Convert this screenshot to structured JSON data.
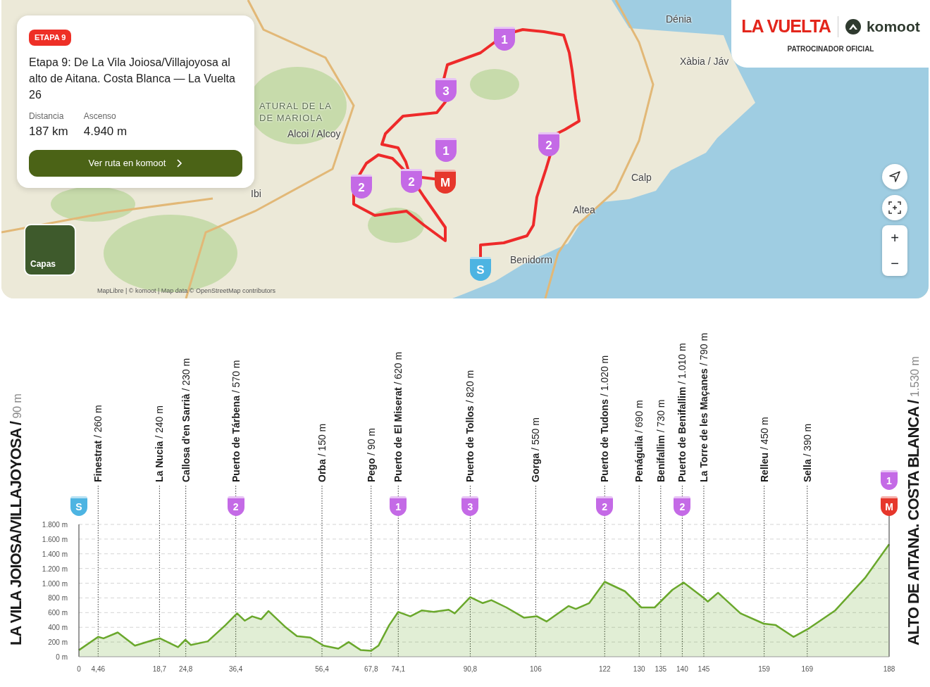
{
  "map": {
    "card": {
      "badge": "ETAPA 9",
      "title": "Etapa 9: De La Vila Joiosa/Villajoyosa al alto de Aitana. Costa Blanca — La Vuelta 26",
      "stats": [
        {
          "label": "Distancia",
          "value": "187 km"
        },
        {
          "label": "Ascenso",
          "value": "4.940 m"
        }
      ],
      "button": "Ver ruta en komoot"
    },
    "sponsor": {
      "brand": "LA VUELTA",
      "partner": "komoot",
      "caption": "PATROCINADOR OFICIAL"
    },
    "places": [
      "Dénia",
      "Xàbia / Jáv",
      "ATURAL DE LA",
      "DE MARIOLA",
      "Alcoi / Alcoy",
      "Calp",
      "Ibi",
      "Altea",
      "Benidorm"
    ],
    "markers": [
      {
        "text": "1",
        "kind": "climb"
      },
      {
        "text": "3",
        "kind": "climb"
      },
      {
        "text": "2",
        "kind": "climb"
      },
      {
        "text": "1",
        "kind": "climb"
      },
      {
        "text": "2",
        "kind": "climb"
      },
      {
        "text": "M",
        "kind": "finish"
      },
      {
        "text": "2",
        "kind": "climb"
      },
      {
        "text": "S",
        "kind": "start"
      }
    ],
    "layers_button": "Capas",
    "zoom_in": "+",
    "zoom_out": "−",
    "attribution": "MapLibre | © komoot | Map data © OpenStreetMap contributors"
  },
  "profile": {
    "start_title": "**LA VILA JOIOSA/VILLAJOYOSA /** 90 m",
    "finish_title": "**ALTO DE AITANA. COSTA BLANCA /** 1.530 m",
    "chart_data": {
      "type": "area",
      "xlim": [
        0,
        188
      ],
      "ylim": [
        0,
        1800
      ],
      "x": [
        0,
        4.46,
        5.7,
        9,
        13,
        17.4,
        18.8,
        23,
        24.7,
        26,
        29.9,
        34,
        36.7,
        38.5,
        40.2,
        42.3,
        44,
        47.8,
        50.6,
        53.7,
        56.8,
        60.2,
        62.6,
        65.4,
        67.8,
        69.5,
        72,
        74.1,
        76.9,
        79.6,
        82.3,
        85.8,
        87.2,
        90.8,
        93.7,
        95.7,
        99.2,
        103.3,
        106.3,
        108.5,
        113.6,
        115.3,
        118.4,
        122,
        126.7,
        130.5,
        133.6,
        137.7,
        140.3,
        145.2,
        145.9,
        148.3,
        153.5,
        158.9,
        161.7,
        165.8,
        169.5,
        175.5,
        182.4,
        188
      ],
      "series": [
        {
          "color": "#6aa82c",
          "values": [
            90,
            270,
            250,
            330,
            150,
            230,
            250,
            130,
            230,
            160,
            210,
            430,
            590,
            490,
            550,
            510,
            620,
            410,
            280,
            260,
            150,
            110,
            200,
            90,
            80,
            150,
            430,
            610,
            550,
            630,
            610,
            640,
            590,
            810,
            730,
            770,
            670,
            530,
            550,
            480,
            690,
            650,
            730,
            1020,
            890,
            670,
            670,
            910,
            1010,
            790,
            750,
            870,
            590,
            450,
            430,
            270,
            390,
            630,
            1070,
            1530
          ]
        }
      ],
      "yticks": [
        {
          "value": 0,
          "label": "0 m"
        },
        {
          "value": 200,
          "label": "200 m"
        },
        {
          "value": 400,
          "label": "400 m"
        },
        {
          "value": 600,
          "label": "600 m"
        },
        {
          "value": 800,
          "label": "800 m"
        },
        {
          "value": 1000,
          "label": "1.000 m"
        },
        {
          "value": 1200,
          "label": "1.200 m"
        },
        {
          "value": 1400,
          "label": "1.400 m"
        },
        {
          "value": 1600,
          "label": "1.600 m"
        },
        {
          "value": 1800,
          "label": "1.800 m"
        }
      ],
      "xticks": [
        {
          "value": 0,
          "label": "0"
        },
        {
          "value": 4.46,
          "label": "4,46"
        },
        {
          "value": 18.7,
          "label": "18,7"
        },
        {
          "value": 24.8,
          "label": "24,8"
        },
        {
          "value": 36.4,
          "label": "36,4"
        },
        {
          "value": 56.4,
          "label": "56,4"
        },
        {
          "value": 67.8,
          "label": "67,8"
        },
        {
          "value": 74.1,
          "label": "74,1"
        },
        {
          "value": 90.8,
          "label": "90,8"
        },
        {
          "value": 106,
          "label": "106"
        },
        {
          "value": 122,
          "label": "122"
        },
        {
          "value": 130,
          "label": "130"
        },
        {
          "value": 135,
          "label": "135"
        },
        {
          "value": 140,
          "label": "140"
        },
        {
          "value": 145,
          "label": "145"
        },
        {
          "value": 159,
          "label": "159"
        },
        {
          "value": 169,
          "label": "169"
        },
        {
          "value": 188,
          "label": "188"
        }
      ],
      "grid": true
    },
    "waypoints": [
      "**Finestrat** / 260 m",
      "**La Nucia** / 240 m",
      "**Callosa d'en Sarrià** / 230 m",
      "**Puerto de Tárbena** / 570 m",
      "**Orba** / 150 m",
      "**Pego** / 90 m",
      "**Puerto de El Miserat** / 620 m",
      "**Puerto de Tollos** / 820 m",
      "**Gorga** / 550 m",
      "**Puerto de Tudons** / 1.020 m",
      "**Penáguila** / 690 m",
      "**Benifallim** / 730 m",
      "**Puerto de Benifallim** / 1.010 m",
      "**La Torre de les Maçanes** / 790 m",
      "**Relleu** / 450 m",
      "**Sella** / 390 m"
    ],
    "badges": [
      {
        "text": "S",
        "kind": "start"
      },
      {
        "text": "2",
        "kind": "climb"
      },
      {
        "text": "1",
        "kind": "climb"
      },
      {
        "text": "3",
        "kind": "climb"
      },
      {
        "text": "2",
        "kind": "climb"
      },
      {
        "text": "2",
        "kind": "climb"
      },
      {
        "text": "1",
        "kind": "climb"
      },
      {
        "text": "M",
        "kind": "finish"
      }
    ]
  }
}
